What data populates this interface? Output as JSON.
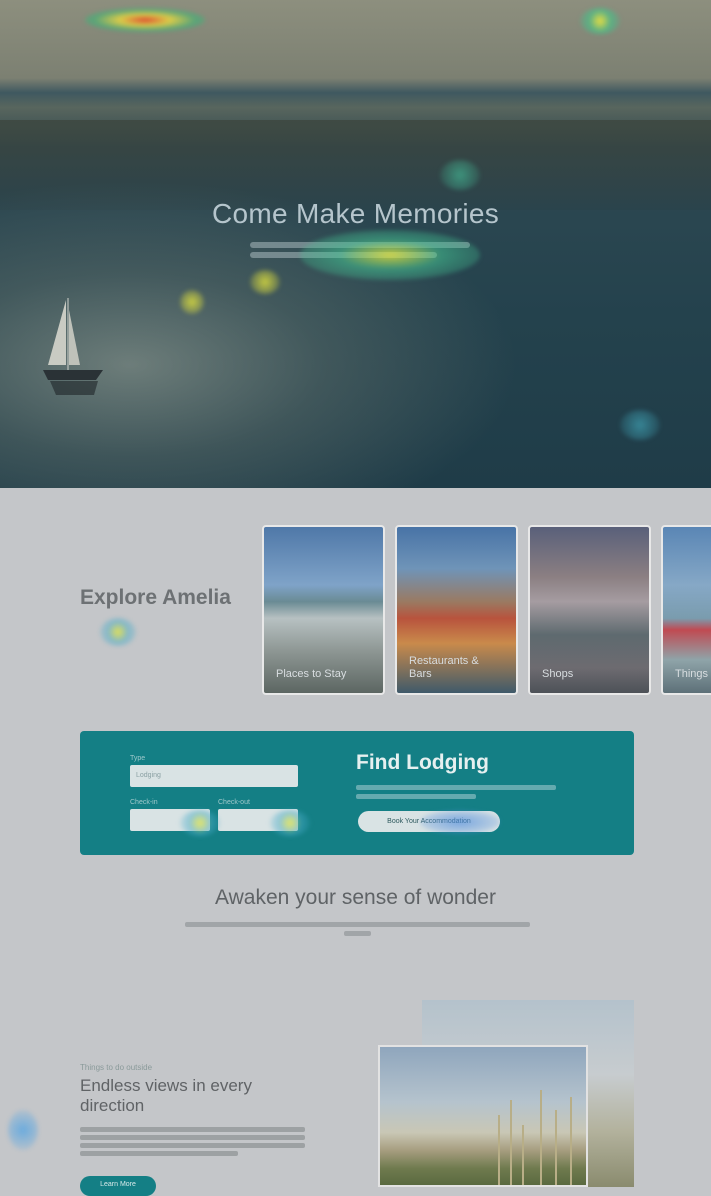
{
  "hero": {
    "nav_left": "",
    "nav_center": "",
    "nav_right": "",
    "title": "Come Make Memories"
  },
  "explore": {
    "title": "Explore Amelia",
    "cards": [
      {
        "label": "Places to Stay"
      },
      {
        "label": "Restaurants & Bars"
      },
      {
        "label": "Shops"
      },
      {
        "label": "Things"
      }
    ]
  },
  "lodging": {
    "type_label": "Type",
    "type_value": "Lodging",
    "checkin_label": "Check-in",
    "checkin_value": "",
    "checkout_label": "Check-out",
    "checkout_value": "",
    "title": "Find Lodging",
    "button": "Book Your Accommodation"
  },
  "wonder": {
    "title": "Awaken your sense of wonder"
  },
  "endless": {
    "eyebrow": "Things to do outside",
    "title": "Endless views in every direction",
    "button": "Learn More"
  },
  "colors": {
    "accent": "#147f85",
    "overlay": "#c4c6c9"
  }
}
